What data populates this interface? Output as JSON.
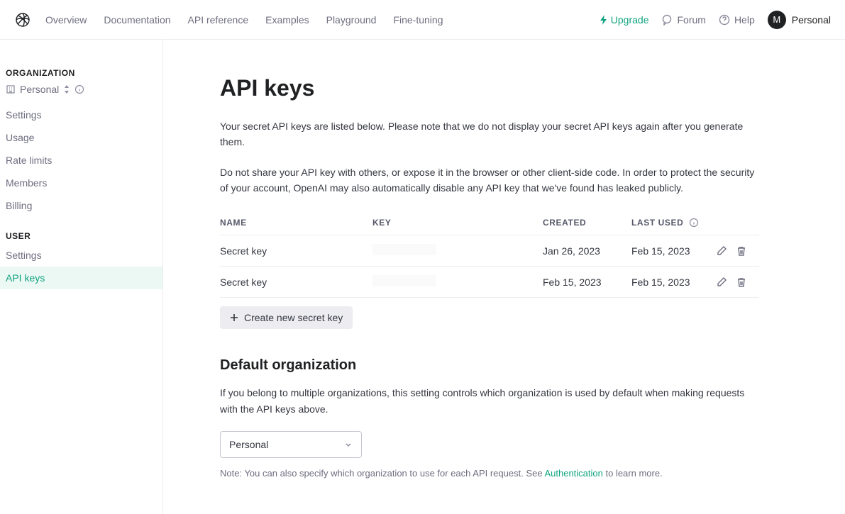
{
  "nav": {
    "links": [
      "Overview",
      "Documentation",
      "API reference",
      "Examples",
      "Playground",
      "Fine-tuning"
    ],
    "upgrade": "Upgrade",
    "forum": "Forum",
    "help": "Help",
    "avatar_initial": "M",
    "account_label": "Personal"
  },
  "sidebar": {
    "org_heading": "ORGANIZATION",
    "org_name": "Personal",
    "org_items": [
      "Settings",
      "Usage",
      "Rate limits",
      "Members",
      "Billing"
    ],
    "user_heading": "USER",
    "user_items": [
      "Settings",
      "API keys"
    ]
  },
  "page": {
    "title": "API keys",
    "intro1": "Your secret API keys are listed below. Please note that we do not display your secret API keys again after you generate them.",
    "intro2": "Do not share your API key with others, or expose it in the browser or other client-side code. In order to protect the security of your account, OpenAI may also automatically disable any API key that we've found has leaked publicly.",
    "table": {
      "headers": {
        "name": "NAME",
        "key": "KEY",
        "created": "CREATED",
        "last_used": "LAST USED"
      },
      "rows": [
        {
          "name": "Secret key",
          "created": "Jan 26, 2023",
          "last_used": "Feb 15, 2023"
        },
        {
          "name": "Secret key",
          "created": "Feb 15, 2023",
          "last_used": "Feb 15, 2023"
        }
      ]
    },
    "create_label": "Create new secret key",
    "default_org_heading": "Default organization",
    "default_org_para": "If you belong to multiple organizations, this setting controls which organization is used by default when making requests with the API keys above.",
    "default_org_selected": "Personal",
    "note_prefix": "Note: You can also specify which organization to use for each API request. See ",
    "note_link": "Authentication",
    "note_suffix": " to learn more."
  }
}
